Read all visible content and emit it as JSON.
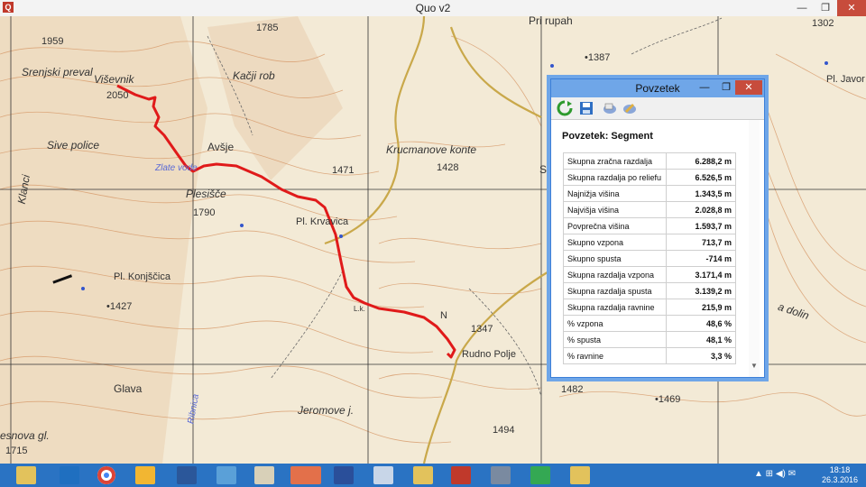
{
  "window": {
    "title": "Quo v2",
    "app_icon_text": "Q",
    "min_glyph": "—",
    "max_glyph": "❐",
    "close_glyph": "✕"
  },
  "map": {
    "labels": {
      "l1959": "1959",
      "srenjski": "Srenjski preval",
      "visevnik": "Viševnik",
      "l2050": "2050",
      "l1785": "1785",
      "kacji": "Kačji rob",
      "sive": "Sive police",
      "avsje": "Avšje",
      "zlate": "Zlate vode",
      "plesisce": "Plesišče",
      "l1790": "1790",
      "klanci": "Klanci",
      "konjscica": "Pl. Konjščica",
      "l1427": "•1427",
      "l1471": "1471",
      "krvavica": "Pl. Krvavica",
      "krucmanove": "Krucmanove konte",
      "l1428": "1428",
      "prirupah": "Pri rupah",
      "l1387": "•1387",
      "l1302": "1302",
      "javor": "Pl. Javor",
      "sp": "Sp",
      "n": "N",
      "l1347": "1347",
      "rudno": "Rudno Polje",
      "glava": "Glava",
      "jeromove": "Jeromove j.",
      "ribnica": "Ribnica",
      "l1482": "1482",
      "l1469": "•1469",
      "l1494": "1494",
      "esnova": "esnova gl.",
      "l1715": "1715",
      "dolin": "a dolin",
      "lk": "L.k."
    }
  },
  "povzetek": {
    "title": "Povzetek",
    "heading": "Povzetek: Segment",
    "rows": [
      {
        "label": "Skupna zračna razdalja",
        "value": "6.288,2 m"
      },
      {
        "label": "Skupna razdalja po reliefu",
        "value": "6.526,5 m"
      },
      {
        "label": "Najnižja višina",
        "value": "1.343,5 m"
      },
      {
        "label": "Najvišja višina",
        "value": "2.028,8 m"
      },
      {
        "label": "Povprečna višina",
        "value": "1.593,7 m"
      },
      {
        "label": "Skupno vzpona",
        "value": "713,7 m"
      },
      {
        "label": "Skupno spusta",
        "value": "-714 m"
      },
      {
        "label": "Skupna razdalja vzpona",
        "value": "3.171,4 m"
      },
      {
        "label": "Skupna razdalja spusta",
        "value": "3.139,2 m"
      },
      {
        "label": "Skupna razdalja ravnine",
        "value": "215,9 m"
      },
      {
        "label": "% vzpona",
        "value": "48,6 %"
      },
      {
        "label": "% spusta",
        "value": "48,1 %"
      },
      {
        "label": "% ravnine",
        "value": "3,3 %"
      }
    ]
  },
  "taskbar": {
    "icons": [
      "file-explorer-icon",
      "outlook-icon",
      "chrome-icon",
      "internet-explorer-icon",
      "word-icon",
      "photos-icon",
      "image-viewer-icon",
      "quo-icon",
      "remote-icon",
      "paint-icon",
      "ruler-icon",
      "bug-icon",
      "calculator-icon",
      "google-drive-icon",
      "folder-icon"
    ],
    "tray": "▲  ⊞  ◀)  ✉",
    "time": "18:18",
    "date": "26.3.2016"
  }
}
